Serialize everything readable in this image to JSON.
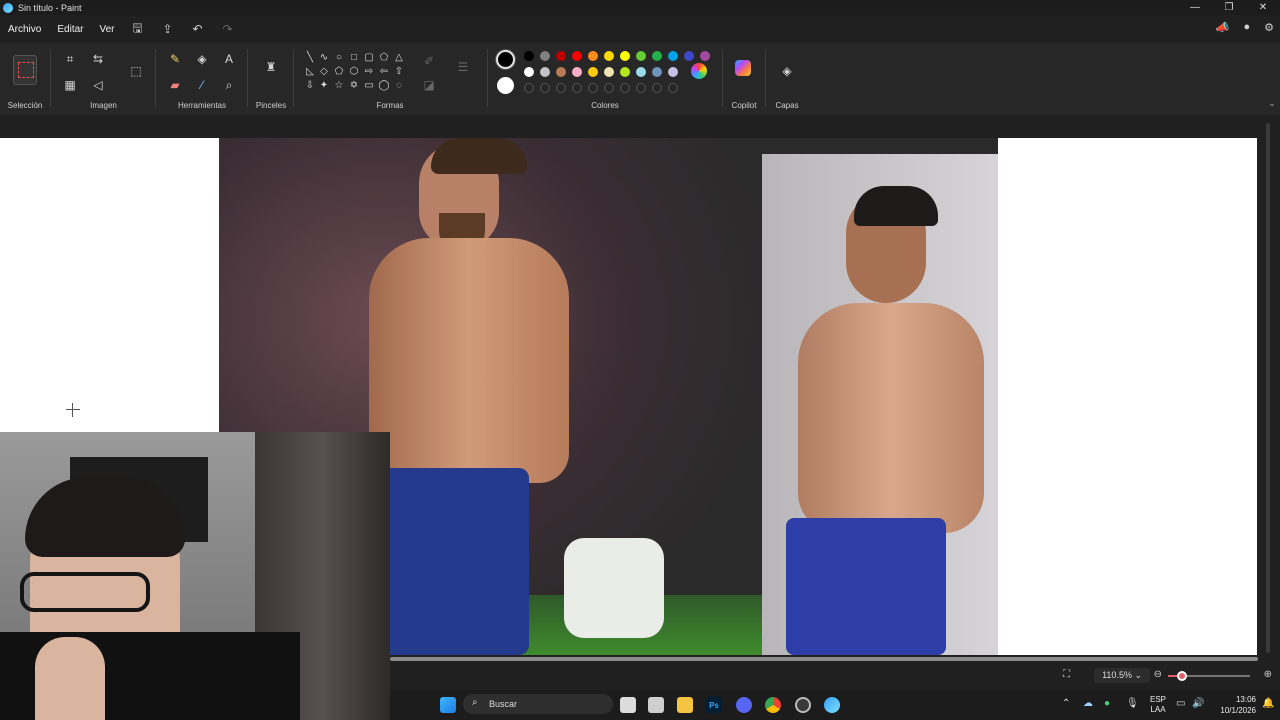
{
  "window": {
    "title": "Sin título - Paint"
  },
  "menu": {
    "archivo": "Archivo",
    "editar": "Editar",
    "ver": "Ver"
  },
  "ribbon": {
    "seleccion": "Selección",
    "imagen": "Imagen",
    "herramientas": "Herramientas",
    "pinceles": "Pinceles",
    "formas": "Formas",
    "colores": "Colores",
    "copilot": "Copilot",
    "capas": "Capas"
  },
  "colors": {
    "row1": [
      "#000000",
      "#7f7f7f",
      "#c00000",
      "#ff0000",
      "#ff8c1a",
      "#ffd700",
      "#ffff00",
      "#66cc33",
      "#22b14c",
      "#00a2e8",
      "#3f48cc",
      "#a349a4"
    ],
    "row2": [
      "#ffffff",
      "#c3c3c3",
      "#b97a57",
      "#ffaec9",
      "#ffc90e",
      "#efe4b0",
      "#b5e61d",
      "#99d9ea",
      "#7092be",
      "#c8bfe7"
    ]
  },
  "status": {
    "zoom": "110.5%"
  },
  "taskbar": {
    "search_placeholder": "Buscar",
    "lang_top": "ESP",
    "lang_bottom": "LAA",
    "time": "13:06",
    "date": "10/1/2026"
  }
}
